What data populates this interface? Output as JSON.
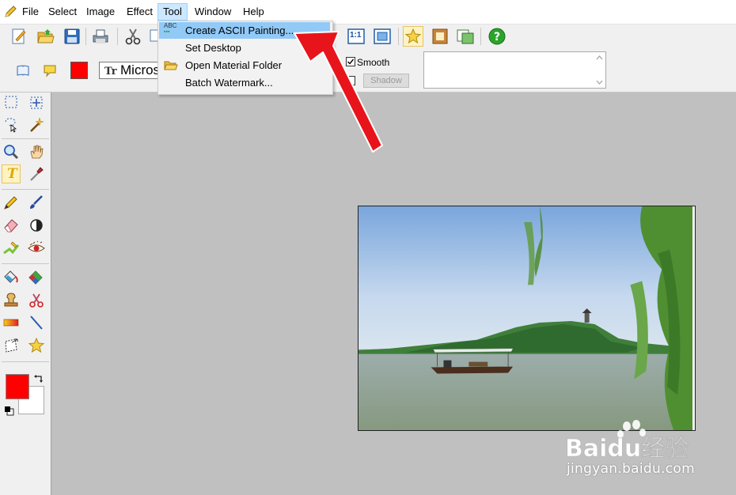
{
  "menu": {
    "items": [
      "File",
      "Select",
      "Image",
      "Effect",
      "Tool",
      "Window",
      "Help"
    ],
    "active": "Tool"
  },
  "tool_menu": {
    "items": [
      {
        "label": "Create ASCII Painting...",
        "icon": "ascii-abc-icon",
        "highlighted": true
      },
      {
        "label": "Set Desktop",
        "icon": "",
        "highlighted": false
      },
      {
        "label": "Open Material Folder",
        "icon": "folder-icon",
        "highlighted": false
      },
      {
        "label": "Batch Watermark...",
        "icon": "",
        "highlighted": false
      }
    ],
    "ascii_icon_text": "ABC"
  },
  "toolbar": {
    "zoom_actual_label": "1:1"
  },
  "propbar": {
    "font_name": "Micros",
    "font_icon_text": "Tr",
    "smooth_label": "Smooth",
    "smooth_checked": true,
    "shadow_checked": false,
    "shadow_button": "Shadow",
    "text_color": "#ff0000"
  },
  "tools": {
    "text_tool_glyph": "T",
    "foreground_color": "#ff0000",
    "background_color": "#ffffff"
  },
  "watermark": {
    "brand_text": "Baidu经验",
    "url_text": "jingyan.baidu.com"
  },
  "annotation": {
    "arrow_color": "#e8141b"
  }
}
